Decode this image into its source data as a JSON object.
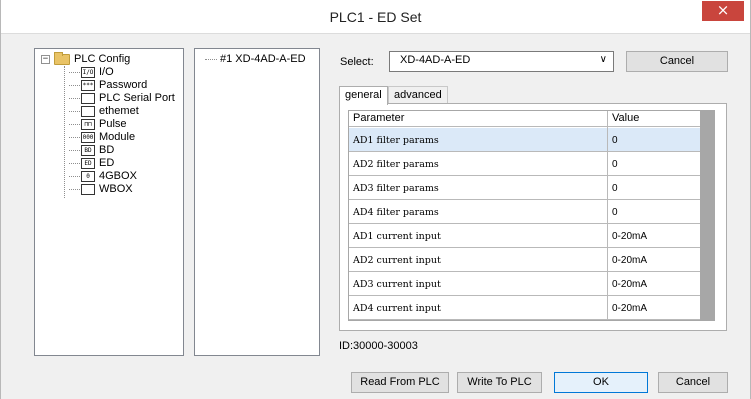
{
  "window": {
    "title": "PLC1 - ED Set",
    "close_glyph": "×"
  },
  "tree": {
    "root_label": "PLC Config",
    "expander_glyph": "−",
    "items": [
      {
        "label": "I/O",
        "icon_text": "I/O",
        "icon": "io-icon"
      },
      {
        "label": "Password",
        "icon_text": "***",
        "icon": "password-icon"
      },
      {
        "label": "PLC Serial Port",
        "icon_text": "",
        "icon": "serial-port-icon"
      },
      {
        "label": "ethemet",
        "icon_text": "",
        "icon": "ethernet-icon"
      },
      {
        "label": "Pulse",
        "icon_text": "⊓⊓",
        "icon": "pulse-icon"
      },
      {
        "label": "Module",
        "icon_text": "000",
        "icon": "module-icon"
      },
      {
        "label": "BD",
        "icon_text": "BD",
        "icon": "bd-icon"
      },
      {
        "label": "ED",
        "icon_text": "ED",
        "icon": "ed-icon"
      },
      {
        "label": "4GBOX",
        "icon_text": "0",
        "icon": "4gbox-icon"
      },
      {
        "label": "WBOX",
        "icon_text": "",
        "icon": "wbox-icon"
      }
    ]
  },
  "device_list": {
    "items": [
      "#1 XD-4AD-A-ED"
    ]
  },
  "select": {
    "label": "Select:",
    "value": "XD-4AD-A-ED",
    "arrow_glyph": "∨"
  },
  "buttons": {
    "cancel_top": "Cancel",
    "read": "Read From PLC",
    "write": "Write To PLC",
    "ok": "OK",
    "cancel_bottom": "Cancel"
  },
  "tabs": [
    {
      "label": "general",
      "active": true
    },
    {
      "label": "advanced",
      "active": false
    }
  ],
  "grid": {
    "headers": [
      "Parameter",
      "Value"
    ],
    "rows": [
      [
        "AD1 filter params",
        "0"
      ],
      [
        "AD2 filter params",
        "0"
      ],
      [
        "AD3 filter params",
        "0"
      ],
      [
        "AD4 filter params",
        "0"
      ],
      [
        "AD1 current input",
        "0-20mA"
      ],
      [
        "AD2 current input",
        "0-20mA"
      ],
      [
        "AD3 current input",
        "0-20mA"
      ],
      [
        "AD4 current input",
        "0-20mA"
      ]
    ]
  },
  "id_text": "ID:30000-30003",
  "colors": {
    "close": "#c9453d",
    "selected_row": "#dbe9f8",
    "focus_border": "#0078d7"
  }
}
